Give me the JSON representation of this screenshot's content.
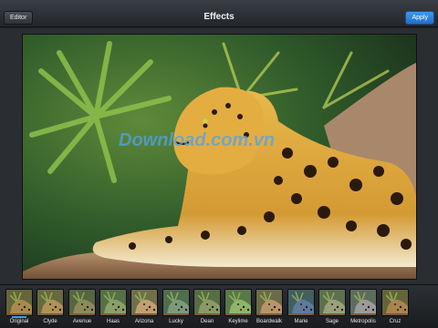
{
  "toolbar": {
    "editor_label": "Editor",
    "title": "Effects",
    "apply_label": "Apply"
  },
  "photo": {
    "subject": "jaguar-on-branch",
    "watermark": "Download.com.vn"
  },
  "filters": {
    "selected": "Original",
    "items": [
      {
        "label": "Original",
        "tint": "#a98a4e"
      },
      {
        "label": "Clyde",
        "tint": "#b09257"
      },
      {
        "label": "Avenue",
        "tint": "#8c8a5c"
      },
      {
        "label": "Haas",
        "tint": "#8aa06a"
      },
      {
        "label": "Arizona",
        "tint": "#c0a070"
      },
      {
        "label": "Lucky",
        "tint": "#7a9a7c"
      },
      {
        "label": "Dean",
        "tint": "#8a9a66"
      },
      {
        "label": "Keylime",
        "tint": "#8fb46a"
      },
      {
        "label": "Boardwalk",
        "tint": "#b8946a"
      },
      {
        "label": "Marie",
        "tint": "#5e7aa0"
      },
      {
        "label": "Sage",
        "tint": "#9aa07c"
      },
      {
        "label": "Metropolis",
        "tint": "#9a9a9a"
      },
      {
        "label": "Cruz",
        "tint": "#a8844e"
      }
    ]
  },
  "colors": {
    "accent": "#2f86dc",
    "selection": "#3aa0ff"
  }
}
